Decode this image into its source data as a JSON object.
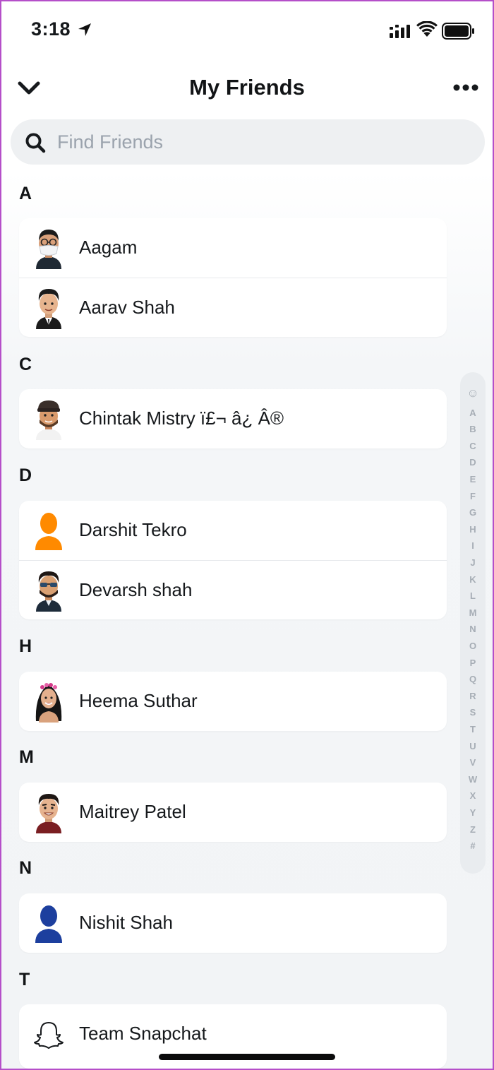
{
  "status_bar": {
    "time": "3:18"
  },
  "header": {
    "title": "My Friends"
  },
  "search": {
    "placeholder": "Find Friends",
    "value": ""
  },
  "sections": [
    {
      "letter": "A",
      "friends": [
        {
          "name": "Aagam",
          "avatar": "bitmoji-mask-glasses"
        },
        {
          "name": "Aarav Shah",
          "avatar": "bitmoji-suit"
        }
      ]
    },
    {
      "letter": "C",
      "friends": [
        {
          "name": "Chintak Mistry ï£¬ â¿ Â®",
          "avatar": "bitmoji-cap-beard"
        }
      ]
    },
    {
      "letter": "D",
      "friends": [
        {
          "name": "Darshit Tekro",
          "avatar": "default-orange-silhouette"
        },
        {
          "name": "Devarsh shah",
          "avatar": "bitmoji-sunglasses-beard"
        }
      ]
    },
    {
      "letter": "H",
      "friends": [
        {
          "name": "Heema Suthar",
          "avatar": "bitmoji-flower-crown"
        }
      ]
    },
    {
      "letter": "M",
      "friends": [
        {
          "name": "Maitrey Patel",
          "avatar": "bitmoji-smile"
        }
      ]
    },
    {
      "letter": "N",
      "friends": [
        {
          "name": "Nishit Shah",
          "avatar": "default-blue-silhouette"
        }
      ]
    },
    {
      "letter": "T",
      "friends": [
        {
          "name": "Team Snapchat",
          "avatar": "snapchat-ghost-icon"
        }
      ]
    }
  ],
  "alpha_index": [
    "☺",
    "A",
    "B",
    "C",
    "D",
    "E",
    "F",
    "G",
    "H",
    "I",
    "J",
    "K",
    "L",
    "M",
    "N",
    "O",
    "P",
    "Q",
    "R",
    "S",
    "T",
    "U",
    "V",
    "W",
    "X",
    "Y",
    "Z",
    "#"
  ],
  "colors": {
    "frame": "#b54fc9",
    "orange_silhouette": "#ff8a00",
    "blue_silhouette": "#1d3f9e"
  }
}
